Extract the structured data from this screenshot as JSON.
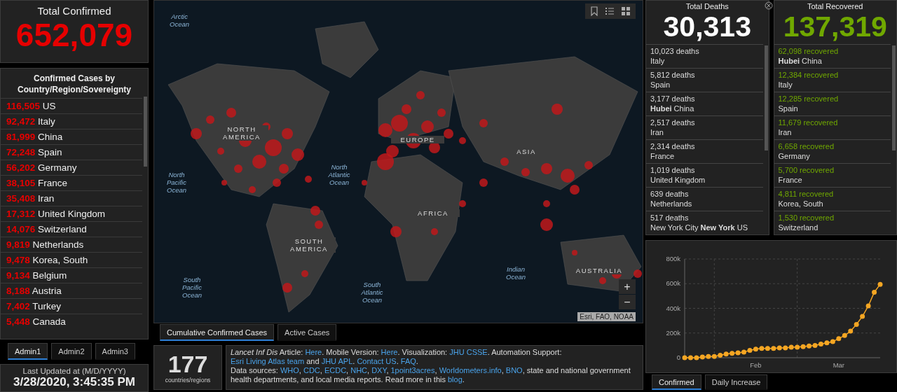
{
  "total_confirmed": {
    "title": "Total Confirmed",
    "value": "652,079"
  },
  "confirmed_list": {
    "title": "Confirmed Cases by Country/Region/Sovereignty",
    "rows": [
      {
        "count": "116,505",
        "place": "US"
      },
      {
        "count": "92,472",
        "place": "Italy"
      },
      {
        "count": "81,999",
        "place": "China"
      },
      {
        "count": "72,248",
        "place": "Spain"
      },
      {
        "count": "56,202",
        "place": "Germany"
      },
      {
        "count": "38,105",
        "place": "France"
      },
      {
        "count": "35,408",
        "place": "Iran"
      },
      {
        "count": "17,312",
        "place": "United Kingdom"
      },
      {
        "count": "14,076",
        "place": "Switzerland"
      },
      {
        "count": "9,819",
        "place": "Netherlands"
      },
      {
        "count": "9,478",
        "place": "Korea, South"
      },
      {
        "count": "9,134",
        "place": "Belgium"
      },
      {
        "count": "8,188",
        "place": "Austria"
      },
      {
        "count": "7,402",
        "place": "Turkey"
      },
      {
        "count": "5,448",
        "place": "Canada"
      }
    ]
  },
  "admin_tabs": [
    {
      "label": "Admin1",
      "selected": true
    },
    {
      "label": "Admin2",
      "selected": false
    },
    {
      "label": "Admin3",
      "selected": false
    }
  ],
  "last_updated": {
    "label": "Last Updated at (M/D/YYYY)",
    "value": "3/28/2020, 3:45:35 PM"
  },
  "map": {
    "labels": [
      {
        "text": "Arctic Ocean",
        "kind": "ocean"
      },
      {
        "text": "NORTH AMERICA",
        "kind": "continent"
      },
      {
        "text": "North Atlantic Ocean",
        "kind": "ocean"
      },
      {
        "text": "EUROPE",
        "kind": "continent"
      },
      {
        "text": "ASIA",
        "kind": "continent"
      },
      {
        "text": "North Pacific Ocean",
        "kind": "ocean"
      },
      {
        "text": "AFRICA",
        "kind": "continent"
      },
      {
        "text": "SOUTH AMERICA",
        "kind": "continent"
      },
      {
        "text": "Indian Ocean",
        "kind": "ocean"
      },
      {
        "text": "AUSTRALIA",
        "kind": "continent"
      },
      {
        "text": "South Pacific Ocean",
        "kind": "ocean"
      },
      {
        "text": "South Atlantic Ocean",
        "kind": "ocean"
      }
    ],
    "zoom_in": "+",
    "zoom_out": "−",
    "attribution": "Esri, FAO, NOAA"
  },
  "map_tabs": [
    {
      "label": "Cumulative Confirmed Cases",
      "selected": true
    },
    {
      "label": "Active Cases",
      "selected": false
    }
  ],
  "countries": {
    "value": "177",
    "label": "countries/regions"
  },
  "info": {
    "paragraphs": [
      [
        {
          "text": "Lancet Inf Dis",
          "kind": "italic"
        },
        {
          "text": " Article: ",
          "kind": "text"
        },
        {
          "text": "Here",
          "kind": "link"
        },
        {
          "text": ". Mobile Version: ",
          "kind": "text"
        },
        {
          "text": "Here",
          "kind": "link"
        },
        {
          "text": ". Visualization: ",
          "kind": "text"
        },
        {
          "text": "JHU CSSE",
          "kind": "link"
        },
        {
          "text": ". Automation Support: ",
          "kind": "text"
        },
        {
          "text": "Esri Living Atlas team",
          "kind": "link"
        },
        {
          "text": " and ",
          "kind": "text"
        },
        {
          "text": "JHU APL",
          "kind": "link"
        },
        {
          "text": ". ",
          "kind": "text"
        },
        {
          "text": "Contact US",
          "kind": "link"
        },
        {
          "text": ". ",
          "kind": "text"
        },
        {
          "text": "FAQ",
          "kind": "link"
        },
        {
          "text": ".",
          "kind": "text"
        }
      ],
      [
        {
          "text": "Data sources: ",
          "kind": "text"
        },
        {
          "text": "WHO",
          "kind": "link"
        },
        {
          "text": ", ",
          "kind": "text"
        },
        {
          "text": "CDC",
          "kind": "link"
        },
        {
          "text": ", ",
          "kind": "text"
        },
        {
          "text": "ECDC",
          "kind": "link"
        },
        {
          "text": ", ",
          "kind": "text"
        },
        {
          "text": "NHC",
          "kind": "link"
        },
        {
          "text": ", ",
          "kind": "text"
        },
        {
          "text": "DXY",
          "kind": "link"
        },
        {
          "text": ", ",
          "kind": "text"
        },
        {
          "text": "1point3acres",
          "kind": "link"
        },
        {
          "text": ", ",
          "kind": "text"
        },
        {
          "text": "Worldometers.info",
          "kind": "link"
        },
        {
          "text": ", ",
          "kind": "text"
        },
        {
          "text": "BNO",
          "kind": "link"
        },
        {
          "text": ", state and national government health departments, and local media reports.  Read more in this ",
          "kind": "text"
        },
        {
          "text": "blog",
          "kind": "link"
        },
        {
          "text": ".",
          "kind": "text"
        }
      ]
    ]
  },
  "total_deaths": {
    "title": "Total Deaths",
    "value": "30,313",
    "rows": [
      {
        "count": "10,023 deaths",
        "place": "Italy"
      },
      {
        "count": "5,812 deaths",
        "place": "Spain"
      },
      {
        "count": "3,177 deaths",
        "place": "**Hubei** China"
      },
      {
        "count": "2,517 deaths",
        "place": "Iran"
      },
      {
        "count": "2,314 deaths",
        "place": "France"
      },
      {
        "count": "1,019 deaths",
        "place": "United Kingdom"
      },
      {
        "count": "639 deaths",
        "place": "Netherlands"
      },
      {
        "count": "517 deaths",
        "place": "New York City **New York** US"
      }
    ]
  },
  "total_recovered": {
    "title": "Total Recovered",
    "value": "137,319",
    "rows": [
      {
        "count": "62,098 recovered",
        "place": "**Hubei** China"
      },
      {
        "count": "12,384 recovered",
        "place": "Italy"
      },
      {
        "count": "12,285 recovered",
        "place": "Spain"
      },
      {
        "count": "11,679 recovered",
        "place": "Iran"
      },
      {
        "count": "6,658 recovered",
        "place": "Germany"
      },
      {
        "count": "5,700 recovered",
        "place": "France"
      },
      {
        "count": "4,811 recovered",
        "place": "Korea, South"
      },
      {
        "count": "1,530 recovered",
        "place": "Switzerland"
      }
    ]
  },
  "chart": {
    "chart_data": {
      "type": "line",
      "categories": [
        null,
        null,
        null,
        null,
        null,
        null,
        null,
        null,
        null,
        null,
        null,
        null,
        "Feb",
        null,
        null,
        null,
        null,
        null,
        null,
        null,
        null,
        null,
        null,
        null,
        null,
        null,
        "Mar",
        null,
        null,
        null,
        null,
        null,
        null,
        null
      ],
      "grid": true,
      "series": [
        {
          "color": "#f5a623",
          "marker": "circle",
          "values": [
            0,
            0,
            0,
            5000,
            10000,
            10000,
            20000,
            30000,
            35000,
            40000,
            45000,
            60000,
            70000,
            75000,
            75000,
            75000,
            80000,
            80000,
            85000,
            85000,
            90000,
            95000,
            100000,
            110000,
            120000,
            130000,
            155000,
            180000,
            215000,
            270000,
            335000,
            420000,
            530000,
            595000
          ]
        }
      ],
      "ylim": [
        0,
        800000
      ],
      "yticks": [
        {
          "value": 0,
          "label": "0"
        },
        {
          "value": 200000,
          "label": "200k"
        },
        {
          "value": 400000,
          "label": "400k"
        },
        {
          "value": 600000,
          "label": "600k"
        },
        {
          "value": 800000,
          "label": "800k"
        }
      ]
    }
  },
  "chart_tabs": [
    {
      "label": "Confirmed",
      "selected": true
    },
    {
      "label": "Daily Increase",
      "selected": false
    }
  ]
}
